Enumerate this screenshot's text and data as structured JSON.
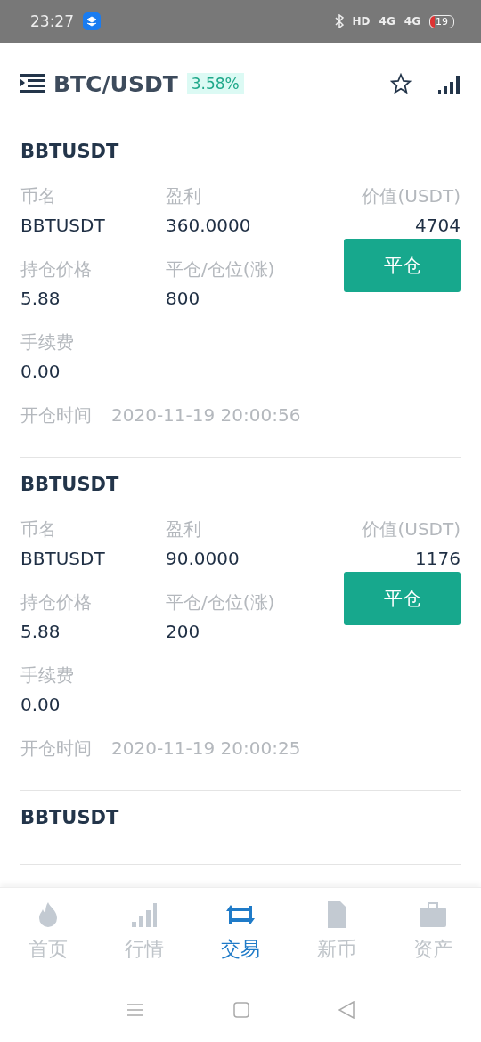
{
  "status_bar": {
    "time": "23:27",
    "hd": "HD",
    "network_1": "4G",
    "network_2": "4G",
    "battery": "19"
  },
  "header": {
    "title": "BTC/USDT",
    "change": "3.58%"
  },
  "positions": [
    {
      "title": "BBTUSDT",
      "fields": [
        {
          "label": "币名",
          "value": "BBTUSDT"
        },
        {
          "label": "盈利",
          "value": "360.0000"
        },
        {
          "label": "价值(USDT)",
          "value": "4704"
        },
        {
          "label": "持仓价格",
          "value": "5.88"
        },
        {
          "label": "平仓/仓位(涨)",
          "value": "800"
        },
        {
          "label": "手续费",
          "value": "0.00"
        }
      ],
      "close_button": "平仓",
      "time_label": "开仓时间",
      "time": "2020-11-19 20:00:56"
    },
    {
      "title": "BBTUSDT",
      "fields": [
        {
          "label": "币名",
          "value": "BBTUSDT"
        },
        {
          "label": "盈利",
          "value": "90.0000"
        },
        {
          "label": "价值(USDT)",
          "value": "1176"
        },
        {
          "label": "持仓价格",
          "value": "5.88"
        },
        {
          "label": "平仓/仓位(涨)",
          "value": "200"
        },
        {
          "label": "手续费",
          "value": "0.00"
        }
      ],
      "close_button": "平仓",
      "time_label": "开仓时间",
      "time": "2020-11-19 20:00:25"
    },
    {
      "title": "BBTUSDT"
    }
  ],
  "tabs": [
    {
      "kind": "home",
      "label": "首页",
      "selected": false
    },
    {
      "kind": "market",
      "label": "行情",
      "selected": false
    },
    {
      "kind": "trade",
      "label": "交易",
      "selected": true
    },
    {
      "kind": "new",
      "label": "新币",
      "selected": false
    },
    {
      "kind": "assets",
      "label": "资产",
      "selected": false
    }
  ]
}
